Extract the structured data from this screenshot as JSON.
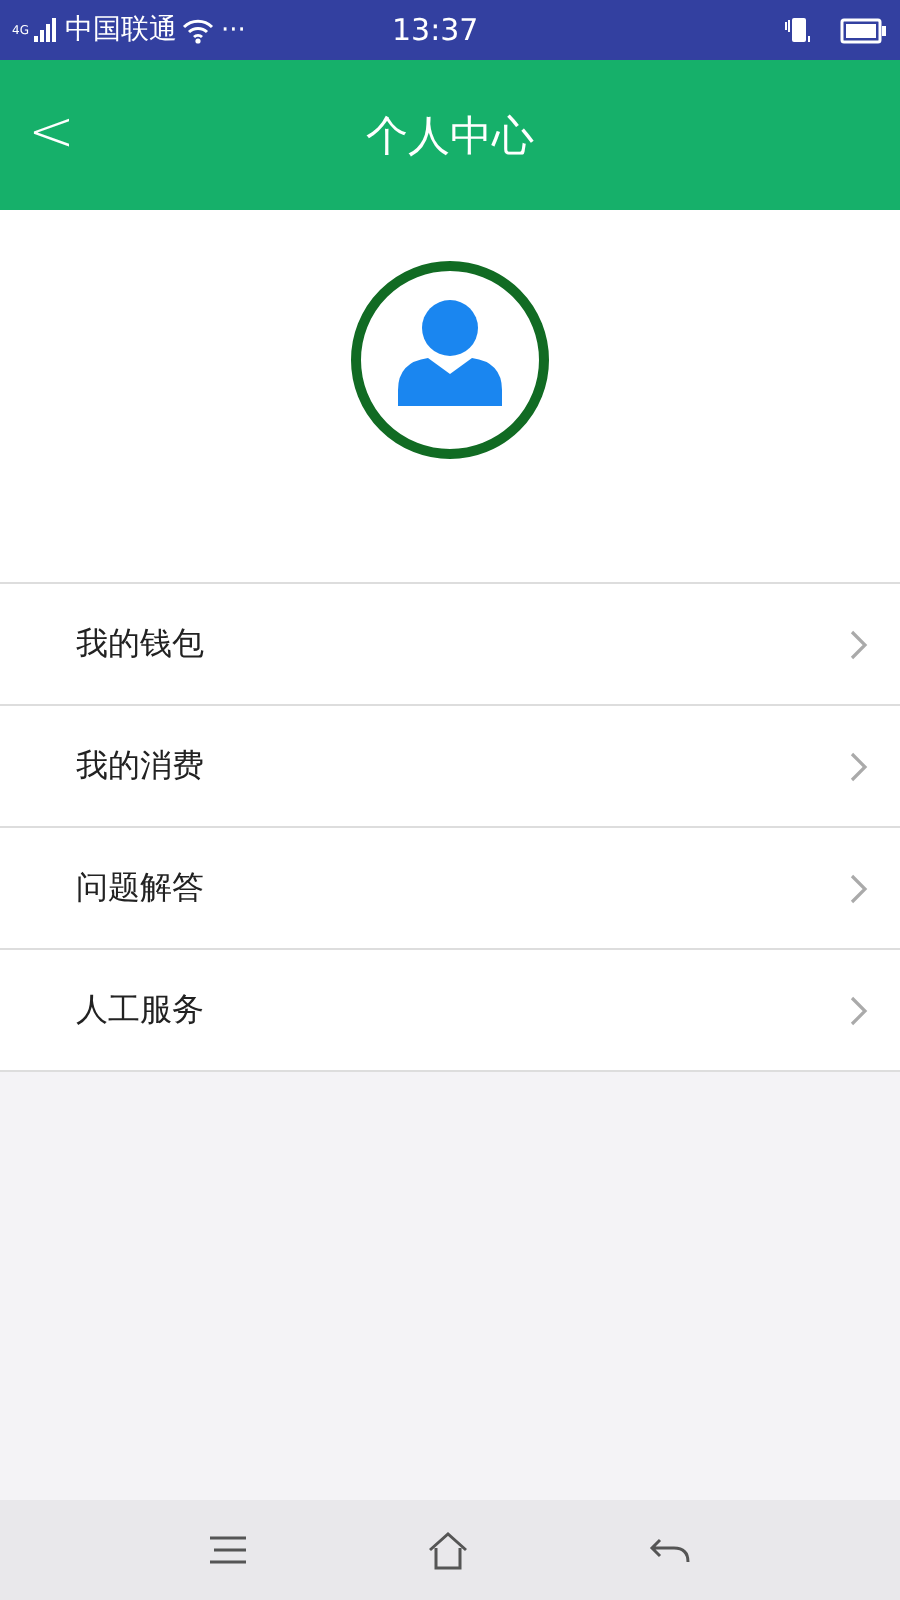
{
  "status_bar": {
    "network": "4G",
    "carrier": "中国联通",
    "more": "···",
    "time": "13:37"
  },
  "header": {
    "back": "<",
    "title": "个人中心"
  },
  "menu": [
    {
      "label": "我的钱包"
    },
    {
      "label": "我的消费"
    },
    {
      "label": "问题解答"
    },
    {
      "label": "人工服务"
    }
  ]
}
